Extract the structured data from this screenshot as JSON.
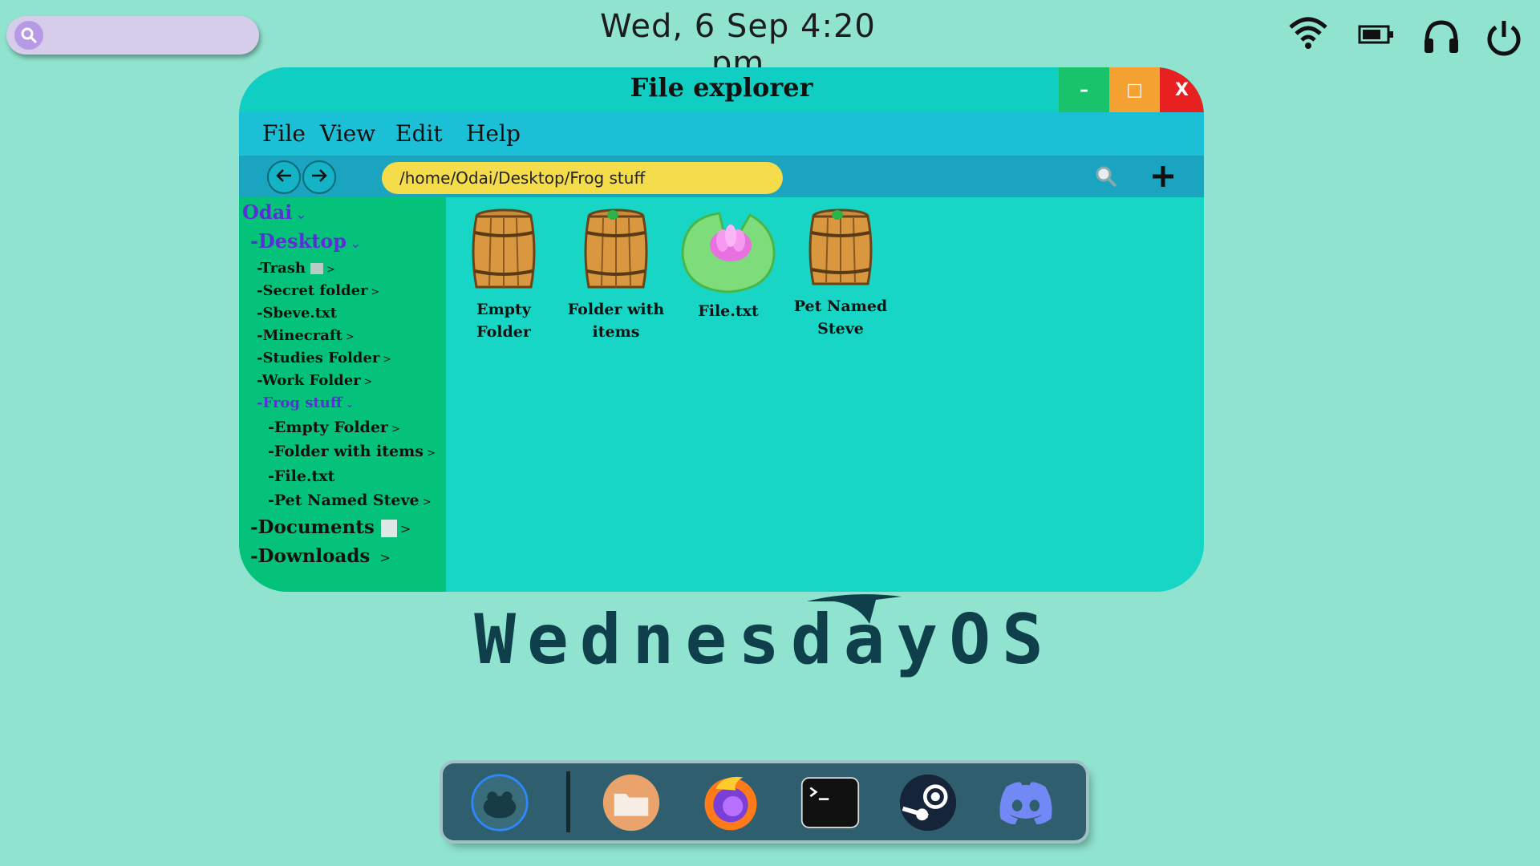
{
  "topbar": {
    "datetime": "Wed, 6 Sep  4:20 pm",
    "icons": [
      "search-icon",
      "wifi-icon",
      "battery-icon",
      "headphones-icon",
      "power-icon"
    ]
  },
  "window": {
    "title": "File explorer",
    "controls": {
      "minimize": "–",
      "maximize": "□",
      "close": "X"
    },
    "menu": [
      "File",
      "View",
      "Edit",
      "Help"
    ],
    "path": "/home/Odai/Desktop/Frog stuff",
    "tree": {
      "root": "Odai",
      "desktop": "Desktop",
      "desktop_items": [
        "Trash",
        "Secret folder",
        "Sbeve.txt",
        "Minecraft",
        "Studies Folder",
        "Work Folder"
      ],
      "frog": "Frog stuff",
      "frog_items": [
        "Empty Folder",
        "Folder with items",
        "File.txt",
        "Pet Named Steve"
      ],
      "documents": "Documents",
      "downloads": "Downloads"
    },
    "files": [
      {
        "label": "Empty Folder",
        "icon": "barrel-icon"
      },
      {
        "label": "Folder with items",
        "icon": "barrel-frog-icon"
      },
      {
        "label": "File.txt",
        "icon": "lilypad-icon"
      },
      {
        "label": "Pet Named Steve",
        "icon": "barrel-frog-icon"
      }
    ]
  },
  "logo": {
    "text": "WednesdayOS"
  },
  "dock": {
    "apps": [
      "frog-launcher",
      "files",
      "firefox",
      "terminal",
      "steam",
      "discord"
    ]
  },
  "colors": {
    "desktop": "#8fe3cf",
    "window": "#18d6c6",
    "sidebar": "#04c27a",
    "menubar": "#1bbfd6",
    "pathbar": "#f5dc4a",
    "selected": "#5b2fd6"
  }
}
